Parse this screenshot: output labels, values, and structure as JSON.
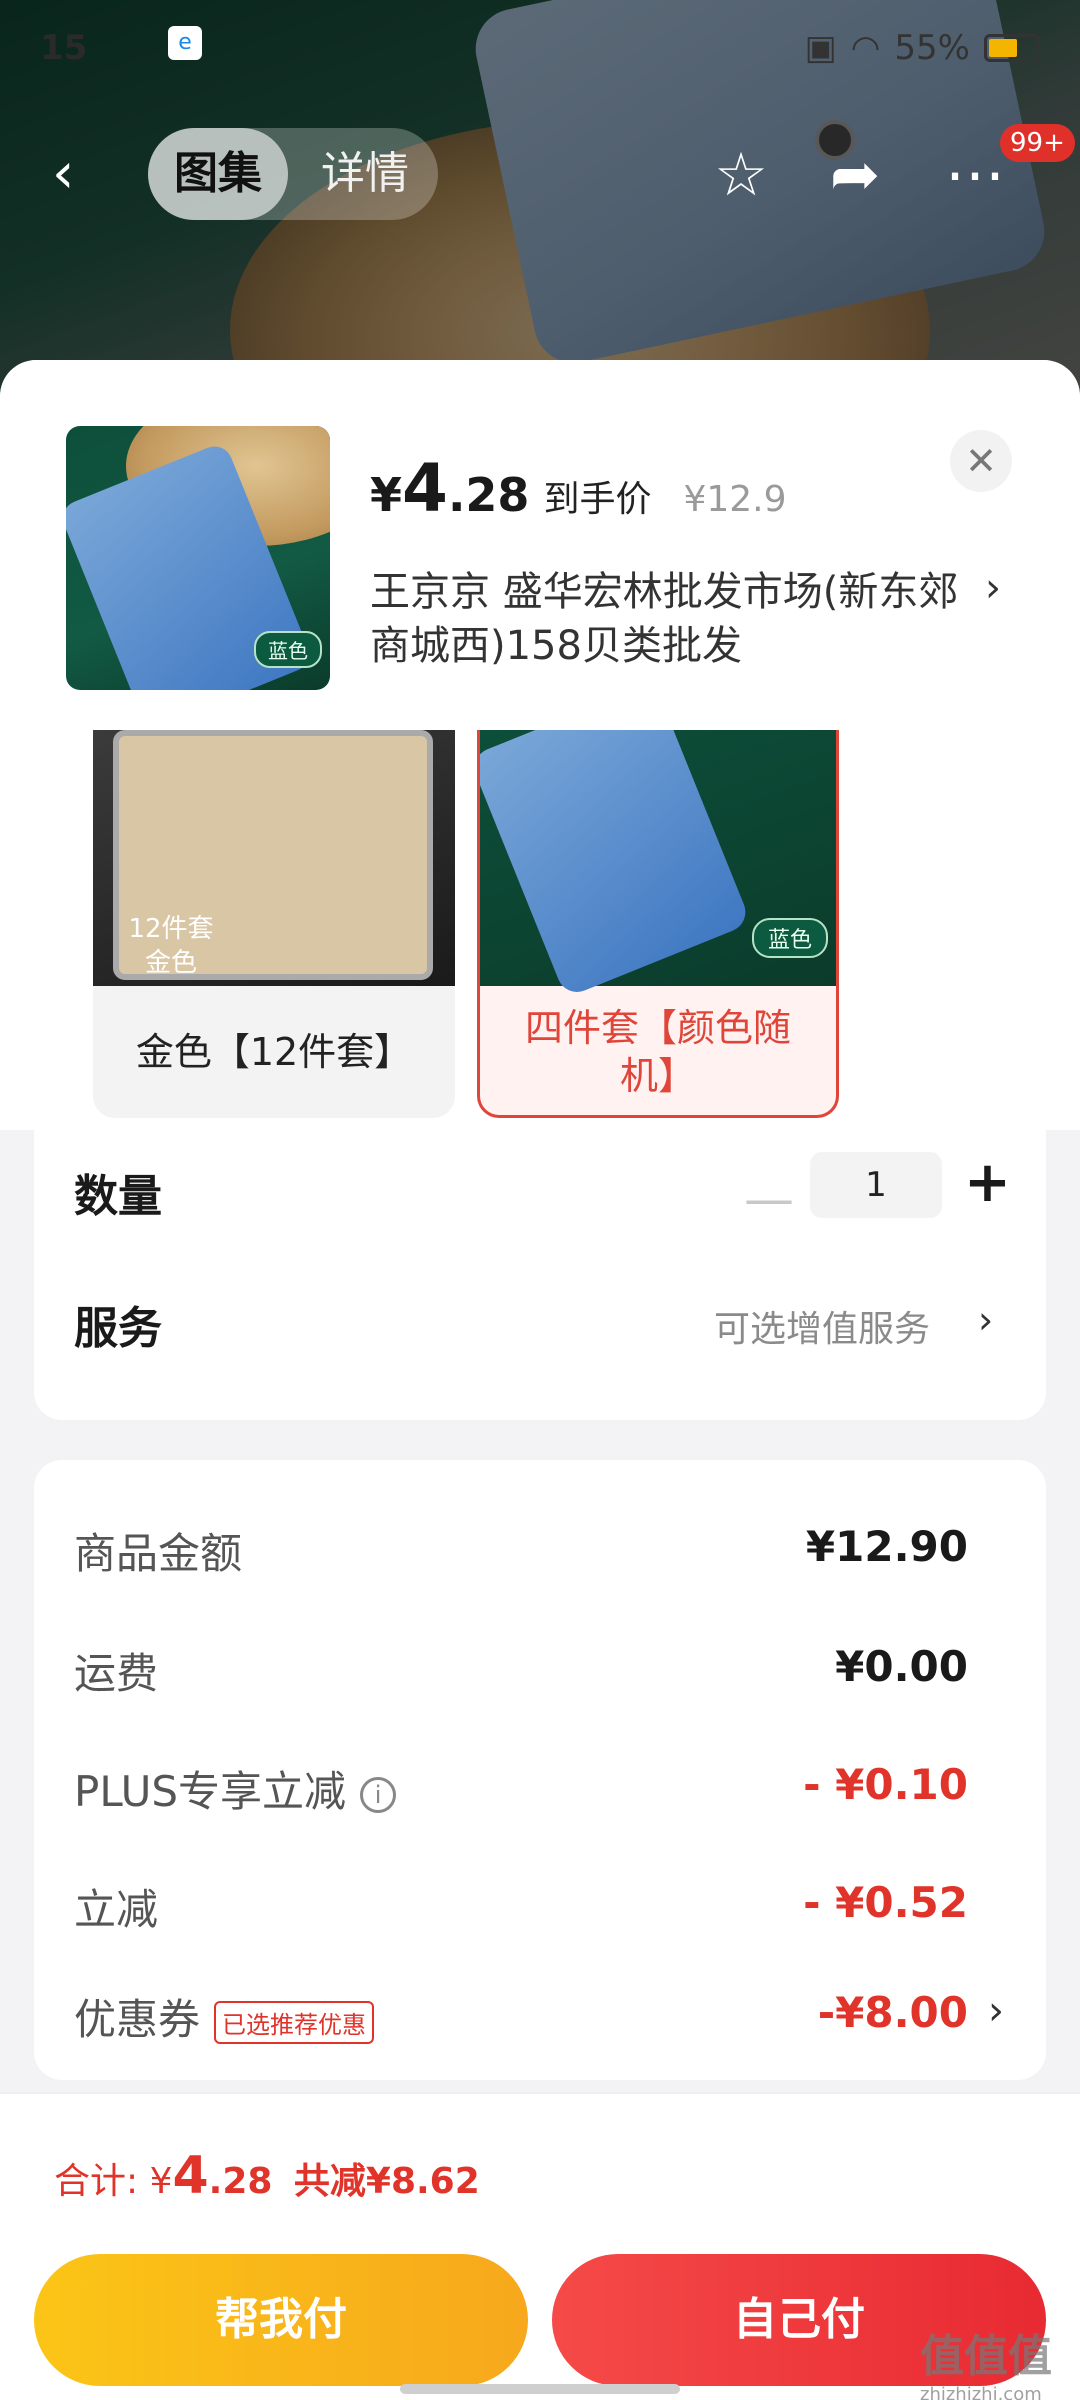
{
  "status_bar": {
    "time": "15",
    "battery_percent": "55%",
    "battery_level": 0.55
  },
  "nav": {
    "tab_gallery": "图集",
    "tab_details": "详情",
    "badge": "99+"
  },
  "sheet": {
    "thumb_tag": "蓝色",
    "price_symbol": "¥",
    "price_int": "4",
    "price_dec": ".28",
    "price_label": "到手价",
    "original_price": "¥12.9",
    "shop_name": "王京京  盛华宏林批发市场(新东郊商城西)158贝类批发",
    "variants": [
      {
        "image_label": "12件套\n金色",
        "label": "金色【12件套】",
        "selected": false
      },
      {
        "image_label": "蓝色",
        "label": "四件套【颜色随机】",
        "selected": true
      }
    ],
    "quantity_label": "数量",
    "quantity_value": "1",
    "service_label": "服务",
    "service_value": "可选增值服务"
  },
  "breakdown": {
    "rows": [
      {
        "label": "商品金额",
        "value": "¥12.90"
      },
      {
        "label": "运费",
        "value": "¥0.00"
      },
      {
        "label": "PLUS专享立减",
        "value": "- ¥0.10"
      },
      {
        "label": "立减",
        "value": "- ¥0.52"
      },
      {
        "label": "优惠券",
        "tag": "已选推荐优惠",
        "value": "-¥8.00"
      }
    ]
  },
  "footer": {
    "total_label": "合计: ",
    "total_symbol": "¥",
    "total_int": "4",
    "total_dec": ".28",
    "saved_text": "共减¥8.62",
    "help_pay": "帮我付",
    "self_pay": "自己付"
  },
  "watermark": {
    "main": "值值值",
    "sub": "zhizhizhi.com"
  },
  "colors": {
    "accent_red": "#e0342b",
    "help_yellow": "#fbc516"
  }
}
